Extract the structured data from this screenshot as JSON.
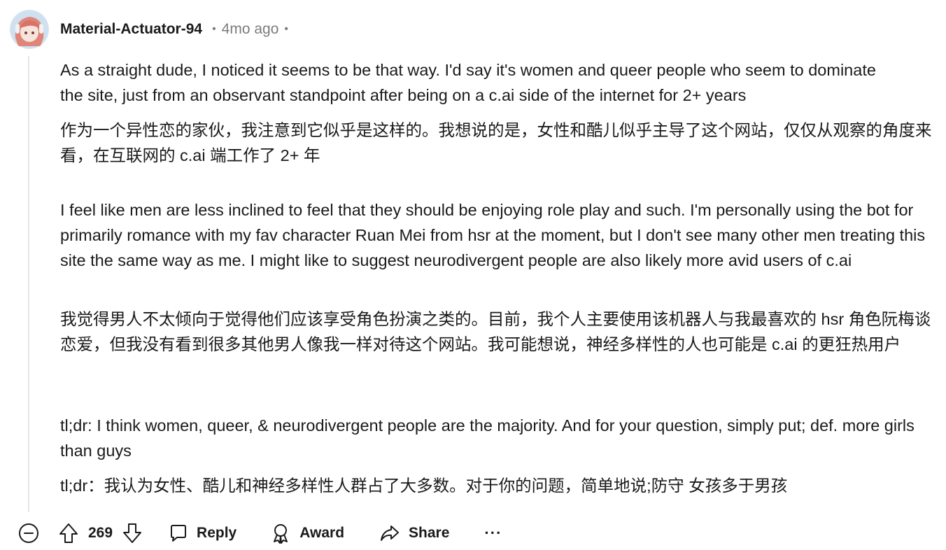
{
  "comment": {
    "author": "Material-Actuator-94",
    "separator": "•",
    "time": "4mo ago",
    "paragraphs": [
      "As a straight dude, I noticed it seems to be that way. I'd say it's women and queer people who seem to dominate the site, just from an observant standpoint after being on a c.ai side of the internet for 2+ years",
      "作为一个异性恋的家伙，我注意到它似乎是这样的。我想说的是，女性和酷儿似乎主导了这个网站，仅仅从观察的角度来看，在互联网的 c.ai 端工作了 2+ 年",
      "I feel like men are less inclined to feel that they should be enjoying role play and such. I'm personally using the bot for primarily romance with my fav character Ruan Mei from hsr at the moment, but I don't see many other men treating this site the same way as me. I might like to suggest neurodivergent people are also likely more avid users of c.ai",
      "我觉得男人不太倾向于觉得他们应该享受角色扮演之类的。目前，我个人主要使用该机器人与我最喜欢的 hsr 角色阮梅谈恋爱，但我没有看到很多其他男人像我一样对待这个网站。我可能想说，神经多样性的人也可能是 c.ai 的更狂热用户",
      "tl;dr: I think women, queer, & neurodivergent people are the majority. And for your question, simply put; def. more girls than guys",
      "tl;dr：我认为女性、酷儿和神经多样性人群占了大多数。对于你的问题，简单地说;防守 女孩多于男孩"
    ]
  },
  "actions": {
    "score": "269",
    "reply_label": "Reply",
    "award_label": "Award",
    "share_label": "Share",
    "more_label": "···"
  },
  "icons": {
    "collapse": "collapse-minus-icon",
    "upvote": "upvote-arrow-icon",
    "downvote": "downvote-arrow-icon",
    "reply": "speech-bubble-icon",
    "award": "award-icon",
    "share": "share-arrow-icon"
  },
  "colors": {
    "text": "#1a1a1b",
    "meta": "#7c7c7c",
    "thread_line": "#e3e6e8",
    "avatar_hair": "#e0857a"
  }
}
